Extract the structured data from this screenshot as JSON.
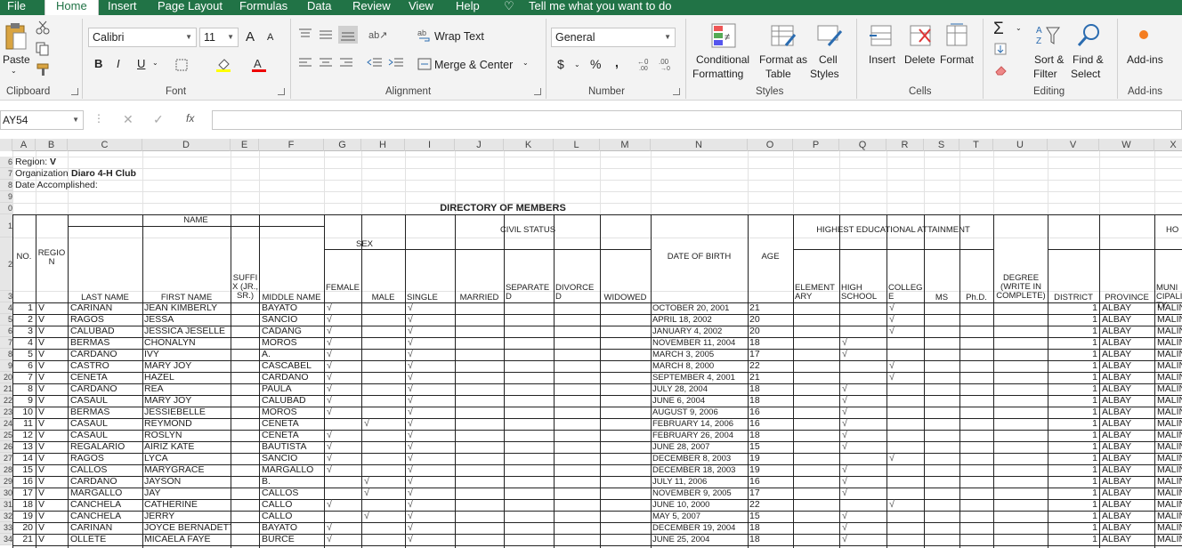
{
  "ribbon_tabs": [
    "File",
    "Home",
    "Insert",
    "Page Layout",
    "Formulas",
    "Data",
    "Review",
    "View",
    "Help"
  ],
  "tell_me": "Tell me what you want to do",
  "clipboard": {
    "paste": "Paste",
    "label": "Clipboard"
  },
  "font": {
    "name": "Calibri",
    "size": "11",
    "bold": "B",
    "italic": "I",
    "underline": "U",
    "label": "Font",
    "grow": "A",
    "shrink": "A"
  },
  "alignment": {
    "wrap": "Wrap Text",
    "merge": "Merge & Center",
    "label": "Alignment"
  },
  "number": {
    "format": "General",
    "currency": "$",
    "percent": "%",
    "comma": ",",
    "label": "Number"
  },
  "styles": {
    "conditional": "Conditional",
    "formatting": "Formatting",
    "format_as": "Format as",
    "table": "Table",
    "cell": "Cell",
    "cell_styles": "Styles",
    "label": "Styles"
  },
  "cells": {
    "insert": "Insert",
    "delete": "Delete",
    "format": "Format",
    "label": "Cells"
  },
  "editing": {
    "sort": "Sort &",
    "filter": "Filter",
    "find": "Find &",
    "select": "Select",
    "label": "Editing"
  },
  "addins": {
    "btn": "Add-ins",
    "label": "Add-ins"
  },
  "formula_bar": {
    "cell_ref": "AY54",
    "fx": "fx",
    "cancel": "✕",
    "enter": "✓"
  },
  "columns": [
    "A",
    "B",
    "C",
    "D",
    "E",
    "F",
    "G",
    "H",
    "I",
    "J",
    "K",
    "L",
    "M",
    "N",
    "O",
    "P",
    "Q",
    "R",
    "S",
    "T",
    "U",
    "V",
    "W",
    "X"
  ],
  "top_rows": {
    "region_label": "Region:",
    "region_value": "V",
    "org_label": "Organization",
    "org_value": "Diaro 4-H Club",
    "date_label": "Date Accomplished:"
  },
  "title": "DIRECTORY OF MEMBERS",
  "headers": {
    "no": "NO.",
    "region": "REGION",
    "name": "NAME",
    "last": "LAST NAME",
    "first": "FIRST NAME",
    "suffix": "SUFFIX (JR., SR.)",
    "middle": "MIDDLE NAME",
    "sex": "SEX",
    "female": "FEMALE",
    "male": "MALE",
    "civil": "CIVIL STATUS",
    "single": "SINGLE",
    "married": "MARRIED",
    "separated": "SEPARATED",
    "divorced": "DIVORCED",
    "widowed": "WIDOWED",
    "dob": "DATE OF BIRTH",
    "age": "AGE",
    "hea": "HIGHEST EDUCATIONAL ATTAINMENT",
    "elem": "ELEMENTARY",
    "high": "HIGH SCHOOL",
    "college": "COLLEGE",
    "ms": "MS",
    "phd": "Ph.D.",
    "degree": "DEGREE (WRITE IN COMPLETE)",
    "district": "DISTRICT",
    "province": "PROVINCE",
    "muni": "MUNICIPALITY",
    "ho": "HO"
  },
  "row_numbers": [
    "6",
    "7",
    "8",
    "9",
    "0",
    "1",
    "2",
    "3",
    "4",
    "5",
    "6",
    "7",
    "8",
    "9",
    "20",
    "21",
    "22",
    "23",
    "24",
    "25",
    "26",
    "27",
    "28",
    "29",
    "30",
    "31",
    "32",
    "33",
    "34"
  ],
  "members": [
    {
      "no": "1",
      "region": "V",
      "last": "CARINAN",
      "first": "JEAN KIMBERLY",
      "middle": "BAYATO",
      "female": "√",
      "male": "",
      "single": "√",
      "dob": "OCTOBER 20, 2001",
      "age": "21",
      "edu": "college",
      "district": "1",
      "province": "ALBAY",
      "muni": "MALIN"
    },
    {
      "no": "2",
      "region": "V",
      "last": "RAGOS",
      "first": "JESSA",
      "middle": "SANCIO",
      "female": "√",
      "male": "",
      "single": "√",
      "dob": "APRIL 18, 2002",
      "age": "20",
      "edu": "college",
      "district": "1",
      "province": "ALBAY",
      "muni": "MALIN"
    },
    {
      "no": "3",
      "region": "V",
      "last": "CALUBAD",
      "first": "JESSICA JESELLE",
      "middle": "CADANG",
      "female": "√",
      "male": "",
      "single": "√",
      "dob": "JANUARY 4, 2002",
      "age": "20",
      "edu": "college",
      "district": "1",
      "province": "ALBAY",
      "muni": "MALIN"
    },
    {
      "no": "4",
      "region": "V",
      "last": "BERMAS",
      "first": "CHONALYN",
      "middle": "MOROS",
      "female": "√",
      "male": "",
      "single": "√",
      "dob": "NOVEMBER 11, 2004",
      "age": "18",
      "edu": "high",
      "district": "1",
      "province": "ALBAY",
      "muni": "MALIN"
    },
    {
      "no": "5",
      "region": "V",
      "last": "CARDAÑO",
      "first": "IVY",
      "middle": "A.",
      "female": "√",
      "male": "",
      "single": "√",
      "dob": "MARCH 3, 2005",
      "age": "17",
      "edu": "high",
      "district": "1",
      "province": "ALBAY",
      "muni": "MALIN"
    },
    {
      "no": "6",
      "region": "V",
      "last": "CASTRO",
      "first": "MARY JOY",
      "middle": "CASCABEL",
      "female": "√",
      "male": "",
      "single": "√",
      "dob": "MARCH 8, 2000",
      "age": "22",
      "edu": "college",
      "district": "1",
      "province": "ALBAY",
      "muni": "MALIN"
    },
    {
      "no": "7",
      "region": "V",
      "last": "CENETA",
      "first": "HAZEL",
      "middle": "CARDAÑO",
      "female": "√",
      "male": "",
      "single": "√",
      "dob": "SEPTEMBER 4, 2001",
      "age": "21",
      "edu": "college",
      "district": "1",
      "province": "ALBAY",
      "muni": "MALIN"
    },
    {
      "no": "8",
      "region": "V",
      "last": "CARDAÑO",
      "first": "REA",
      "middle": "PAULA",
      "female": "√",
      "male": "",
      "single": "√",
      "dob": "JULY 28, 2004",
      "age": "18",
      "edu": "high",
      "district": "1",
      "province": "ALBAY",
      "muni": "MALIN"
    },
    {
      "no": "9",
      "region": "V",
      "last": "CASAUL",
      "first": "MARY JOY",
      "middle": "CALUBAD",
      "female": "√",
      "male": "",
      "single": "√",
      "dob": "JUNE 6, 2004",
      "age": "18",
      "edu": "high",
      "district": "1",
      "province": "ALBAY",
      "muni": "MALIN"
    },
    {
      "no": "10",
      "region": "V",
      "last": "BERMAS",
      "first": "JESSIEBELLE",
      "middle": "MOROS",
      "female": "√",
      "male": "",
      "single": "√",
      "dob": "AUGUST 9, 2006",
      "age": "16",
      "edu": "high",
      "district": "1",
      "province": "ALBAY",
      "muni": "MALIN"
    },
    {
      "no": "11",
      "region": "V",
      "last": "CASAUL",
      "first": "REYMOND",
      "middle": "CENETA",
      "female": "",
      "male": "√",
      "single": "√",
      "dob": "FEBRUARY 14, 2006",
      "age": "16",
      "edu": "high",
      "district": "1",
      "province": "ALBAY",
      "muni": "MALIN"
    },
    {
      "no": "12",
      "region": "V",
      "last": "CASAUL",
      "first": "ROSLYN",
      "middle": "CENETA",
      "female": "√",
      "male": "",
      "single": "√",
      "dob": "FEBRUARY 26, 2004",
      "age": "18",
      "edu": "high",
      "district": "1",
      "province": "ALBAY",
      "muni": "MALIN"
    },
    {
      "no": "13",
      "region": "V",
      "last": "REGALARIO",
      "first": "AIRIZ KATE",
      "middle": "BAUTISTA",
      "female": "√",
      "male": "",
      "single": "√",
      "dob": "JUNE 28, 2007",
      "age": "15",
      "edu": "high",
      "district": "1",
      "province": "ALBAY",
      "muni": "MALIN"
    },
    {
      "no": "14",
      "region": "V",
      "last": "RAGOS",
      "first": "LYCA",
      "middle": "SANCIO",
      "female": "√",
      "male": "",
      "single": "√",
      "dob": "DECEMBER 8, 2003",
      "age": "19",
      "edu": "college",
      "district": "1",
      "province": "ALBAY",
      "muni": "MALIN"
    },
    {
      "no": "15",
      "region": "V",
      "last": "CALLOS",
      "first": "MARYGRACE",
      "middle": "MARGALLO",
      "female": "√",
      "male": "",
      "single": "√",
      "dob": "DECEMBER 18, 2003",
      "age": "19",
      "edu": "high",
      "district": "1",
      "province": "ALBAY",
      "muni": "MALIN"
    },
    {
      "no": "16",
      "region": "V",
      "last": "CARDAÑO",
      "first": " JAYSON",
      "middle": "B.",
      "female": "",
      "male": "√",
      "single": "√",
      "dob": "JULY 11, 2006",
      "age": "16",
      "edu": "high",
      "district": "1",
      "province": "ALBAY",
      "muni": "MALIN"
    },
    {
      "no": "17",
      "region": "V",
      "last": "MARGALLO",
      "first": "JAY",
      "middle": "CALLOS",
      "female": "",
      "male": "√",
      "single": "√",
      "dob": "NOVEMBER 9, 2005",
      "age": "17",
      "edu": "high",
      "district": "1",
      "province": "ALBAY",
      "muni": "MALIN"
    },
    {
      "no": "18",
      "region": "V",
      "last": "CANCHELA",
      "first": "CATHERINE",
      "middle": "CALLO",
      "female": "√",
      "male": "",
      "single": "√",
      "dob": "JUNE 10, 2000",
      "age": "22",
      "edu": "college",
      "district": "1",
      "province": "ALBAY",
      "muni": "MALIN"
    },
    {
      "no": "19",
      "region": "V",
      "last": "CANCHELA",
      "first": "JERRY",
      "middle": "CALLO",
      "female": "",
      "male": "√",
      "single": "√",
      "dob": "MAY 5, 2007",
      "age": "15",
      "edu": "high",
      "district": "1",
      "province": "ALBAY",
      "muni": "MALIN"
    },
    {
      "no": "20",
      "region": "V",
      "last": "CARINAN",
      "first": "JOYCE BERNADETTE",
      "middle": "BAYATO",
      "female": "√",
      "male": "",
      "single": "√",
      "dob": "DECEMBER 19, 2004",
      "age": "18",
      "edu": "high",
      "district": "1",
      "province": "ALBAY",
      "muni": "MALIN"
    },
    {
      "no": "21",
      "region": "V",
      "last": "OLLETE",
      "first": "MICAELA FAYE",
      "middle": "BURCE",
      "female": "√",
      "male": "",
      "single": "√",
      "dob": "JUNE 25, 2004",
      "age": "18",
      "edu": "high",
      "district": "1",
      "province": "ALBAY",
      "muni": "MALIN"
    }
  ]
}
